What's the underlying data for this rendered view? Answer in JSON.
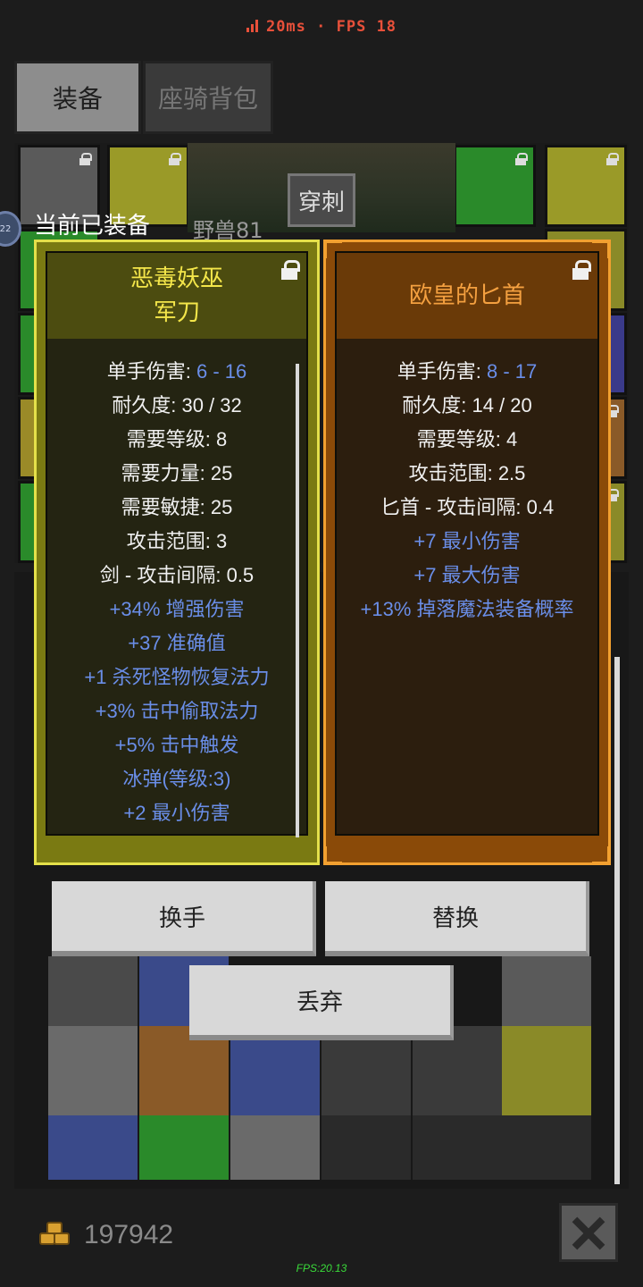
{
  "status": {
    "ping": "20ms",
    "fps": "FPS 18"
  },
  "tabs": [
    {
      "label": "装备",
      "active": true
    },
    {
      "label": "座骑背包",
      "active": false
    }
  ],
  "scene": {
    "skill_tag": "穿刺",
    "target_text": "野兽81",
    "level_badge": "22"
  },
  "equipped_label": "当前已装备",
  "items": {
    "left": {
      "name_lines": [
        "恶毒妖巫",
        "军刀"
      ],
      "locked": true,
      "rarity_color": "#e4e04a",
      "stats": [
        {
          "label": "单手伤害: ",
          "value": "6 - 16"
        },
        {
          "label": "耐久度: 30 / 32",
          "value": ""
        },
        {
          "label": "需要等级: 8",
          "value": ""
        },
        {
          "label": "需要力量: 25",
          "value": ""
        },
        {
          "label": "需要敏捷: 25",
          "value": ""
        },
        {
          "label": "攻击范围: 3",
          "value": ""
        },
        {
          "label": "剑 - 攻击间隔: 0.5",
          "value": ""
        }
      ],
      "bonuses": [
        "+34% 增强伤害",
        "+37 准确值",
        "+1 杀死怪物恢复法力",
        "+3% 击中偷取法力",
        "+5% 击中触发",
        "冰弹(等级:3)",
        "+2 最小伤害"
      ]
    },
    "right": {
      "name": "欧皇的匕首",
      "locked": true,
      "rarity_color": "#f2a030",
      "stats": [
        {
          "label": "单手伤害: ",
          "value": "8 - 17"
        },
        {
          "label": "耐久度: 14 / 20",
          "value": ""
        },
        {
          "label": "需要等级: 4",
          "value": ""
        },
        {
          "label": "攻击范围: 2.5",
          "value": ""
        },
        {
          "label": "匕首 - 攻击间隔: 0.4",
          "value": ""
        }
      ],
      "bonuses": [
        "+7 最小伤害",
        "+7 最大伤害",
        "+13% 掉落魔法装备概率"
      ]
    }
  },
  "actions": {
    "swap_hand": "换手",
    "replace": "替换",
    "discard": "丢弃"
  },
  "gold": "197942",
  "fps_footer": "FPS:20.13"
}
